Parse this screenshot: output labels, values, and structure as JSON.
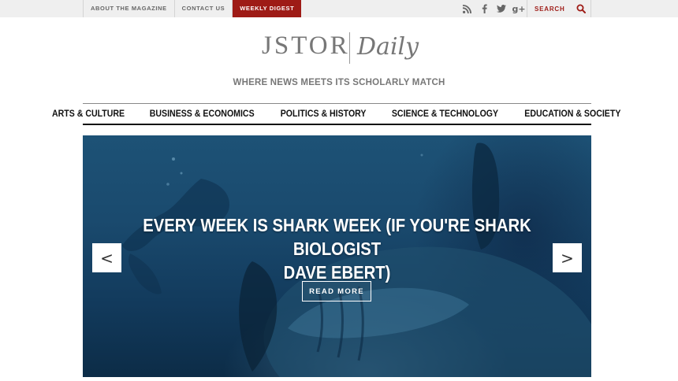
{
  "topbar": {
    "links": [
      "ABOUT THE MAGAZINE",
      "CONTACT US"
    ],
    "digest_label": "WEEKLY DIGEST",
    "social_icons": [
      "rss-icon",
      "facebook-icon",
      "twitter-icon",
      "google-plus-icon"
    ],
    "google_plus_text": "g+",
    "search_label": "SEARCH",
    "accent_color": "#9e1b16"
  },
  "logo": {
    "jstor": "JSTOR",
    "daily": "Daily"
  },
  "tagline": "WHERE NEWS MEETS ITS SCHOLARLY MATCH",
  "nav": {
    "items": [
      "ARTS & CULTURE",
      "BUSINESS & ECONOMICS",
      "POLITICS & HISTORY",
      "SCIENCE & TECHNOLOGY",
      "EDUCATION & SOCIETY"
    ]
  },
  "hero": {
    "title_line1": "EVERY WEEK IS SHARK WEEK (IF YOU'RE SHARK BIOLOGIST",
    "title_line2": "DAVE EBERT)",
    "button": "READ MORE",
    "prev": "<",
    "next": ">"
  }
}
